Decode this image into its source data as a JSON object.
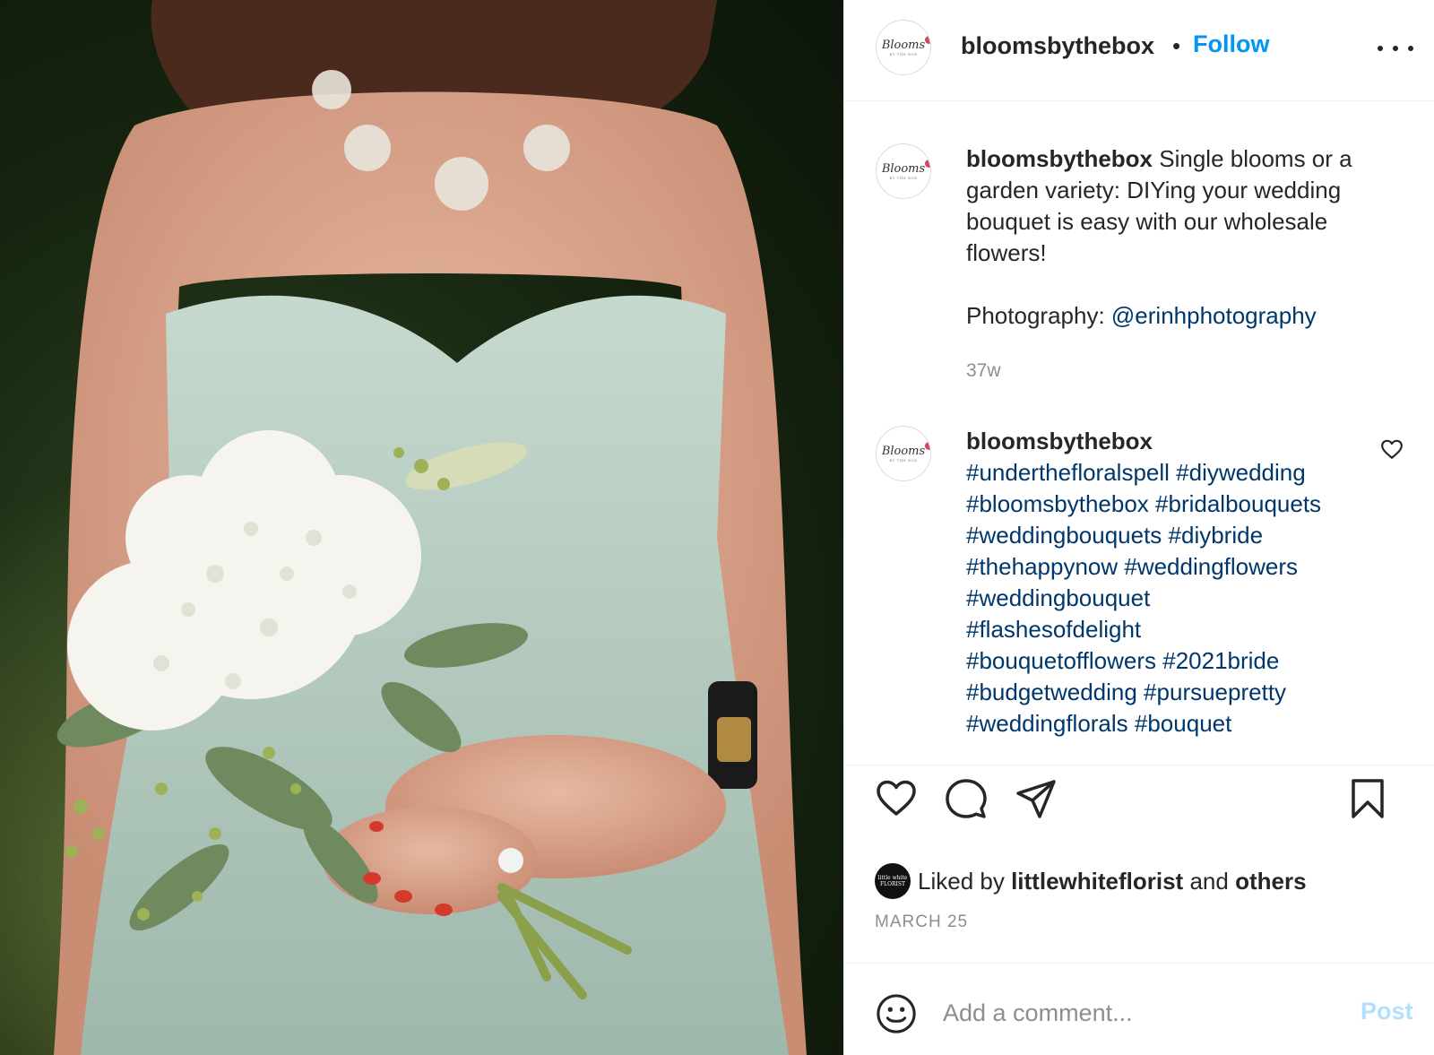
{
  "post": {
    "author": "bloomsbythebox",
    "separator": "•",
    "follow_label": "Follow",
    "avatar_logo_text": "Blooms",
    "avatar_logo_sub": "BY THE BOX"
  },
  "caption": {
    "username": "bloomsbythebox",
    "text": "Single blooms or a garden variety: DIYing your wedding bouquet is easy with our wholesale flowers!",
    "credit_prefix": "Photography:",
    "credit_handle": "@erinhphotography",
    "time_ago": "37w"
  },
  "hashtag_comment": {
    "username": "bloomsbythebox",
    "lines": [
      "#underthefloralspell #diywedding",
      "#bloomsbythebox #bridalbouquets",
      "#weddingbouquets #diybride",
      "#thehappynow #weddingflowers",
      "#weddingbouquet",
      "#flashesofdelight",
      "#bouquetofflowers #2021bride",
      "#budgetwedding #pursuepretty",
      "#weddingflorals #bouquet"
    ]
  },
  "likes": {
    "prefix": "Liked by",
    "user": "littlewhiteflorist",
    "middle": "and",
    "others": "others",
    "avatar_text": "little white FLORIST"
  },
  "date": "MARCH 25",
  "comment_box": {
    "placeholder": "Add a comment...",
    "post_label": "Post"
  },
  "icons": {
    "more": "more-options-icon",
    "like": "heart-icon",
    "comment": "comment-bubble-icon",
    "share": "paper-plane-icon",
    "save": "bookmark-icon",
    "emoji": "smiley-icon"
  },
  "colors": {
    "link": "#0095f6",
    "hashtag": "#00376b",
    "post_disabled": "#b2dffc",
    "muted": "#8e8e8e"
  }
}
